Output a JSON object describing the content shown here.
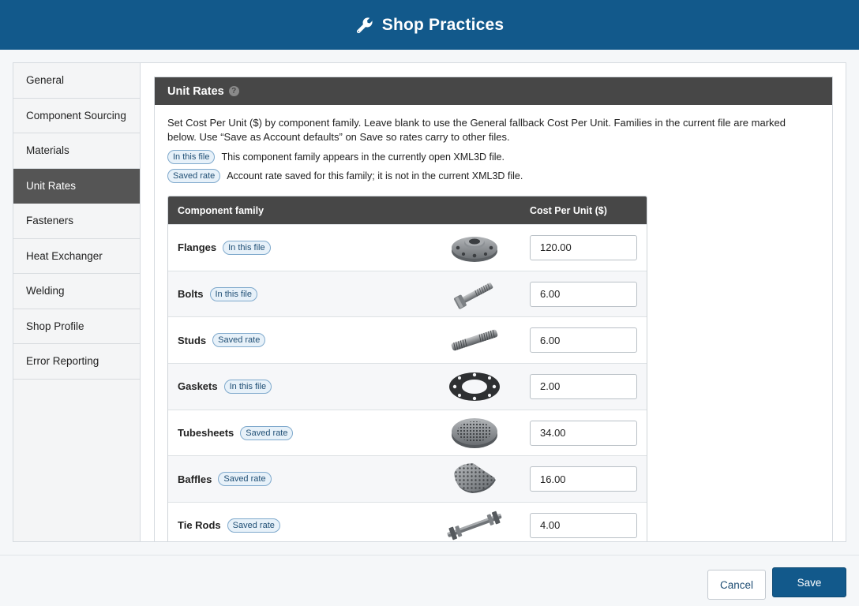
{
  "header": {
    "title": "Shop Practices",
    "icon": "wrench-icon"
  },
  "sidebar": {
    "items": [
      {
        "label": "General",
        "active": false
      },
      {
        "label": "Component Sourcing",
        "active": false
      },
      {
        "label": "Materials",
        "active": false
      },
      {
        "label": "Unit Rates",
        "active": true
      },
      {
        "label": "Fasteners",
        "active": false
      },
      {
        "label": "Heat Exchanger",
        "active": false
      },
      {
        "label": "Welding",
        "active": false
      },
      {
        "label": "Shop Profile",
        "active": false
      },
      {
        "label": "Error Reporting",
        "active": false
      }
    ]
  },
  "section": {
    "title": "Unit Rates",
    "help_icon": "?",
    "description": "Set Cost Per Unit ($) by component family. Leave blank to use the General fallback Cost Per Unit. Families in the current file are marked below. Use “Save as Account defaults” on Save so rates carry to other files.",
    "legend": [
      {
        "badge": "In this file",
        "text": "This component family appears in the currently open XML3D file."
      },
      {
        "badge": "Saved rate",
        "text": "Account rate saved for this family; it is not in the current XML3D file."
      }
    ]
  },
  "table": {
    "headers": {
      "family": "Component family",
      "cost": "Cost Per Unit ($)"
    },
    "rows": [
      {
        "family": "Flanges",
        "badge": "In this file",
        "value": "120.00",
        "image": "flange"
      },
      {
        "family": "Bolts",
        "badge": "In this file",
        "value": "6.00",
        "image": "bolt"
      },
      {
        "family": "Studs",
        "badge": "Saved rate",
        "value": "6.00",
        "image": "stud"
      },
      {
        "family": "Gaskets",
        "badge": "In this file",
        "value": "2.00",
        "image": "gasket"
      },
      {
        "family": "Tubesheets",
        "badge": "Saved rate",
        "value": "34.00",
        "image": "tubesheet"
      },
      {
        "family": "Baffles",
        "badge": "Saved rate",
        "value": "16.00",
        "image": "baffle"
      },
      {
        "family": "Tie Rods",
        "badge": "Saved rate",
        "value": "4.00",
        "image": "tie-rod"
      }
    ]
  },
  "footer": {
    "cancel_label": "Cancel",
    "save_label": "Save"
  },
  "colors": {
    "brand": "#12598b",
    "section_header": "#474747",
    "badge_bg": "#e7f1f9",
    "badge_border": "#7fa9cc"
  }
}
